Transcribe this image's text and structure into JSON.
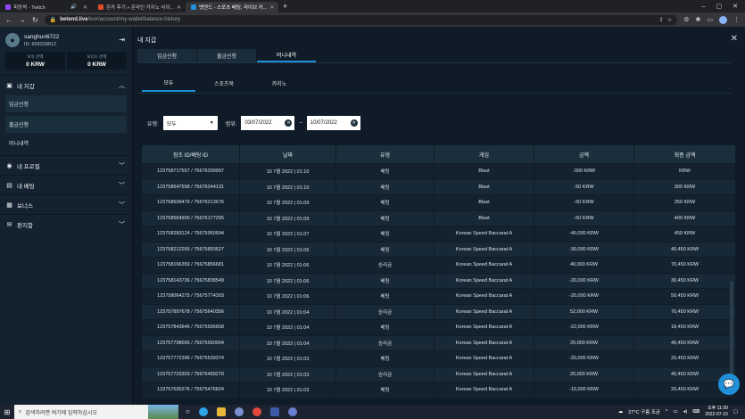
{
  "browser": {
    "tabs": [
      {
        "title": "피망싹 - Twitch",
        "active": false,
        "color": "#9146ff"
      },
      {
        "title": "온카 후기 » 온라인 카지노 사이...",
        "active": false,
        "color": "#e04a2a"
      },
      {
        "title": "벳엔드 - 스포츠 베팅, 라이브 카...",
        "active": true,
        "color": "#1f8fd8"
      }
    ],
    "url_host": "betend.live",
    "url_path": "/ko#/account/my-wallet/balance-history"
  },
  "sidebar": {
    "username": "sanghun6722",
    "user_id": "ID: 669318812",
    "balances": [
      {
        "label": "보유 잔액",
        "value": "0 KRW"
      },
      {
        "label": "보너스 잔액",
        "value": "0 KRW"
      }
    ],
    "menu": {
      "wallet": "내 지갑",
      "deposit": "입금신청",
      "withdraw": "출금신청",
      "money_history": "머니내역",
      "profile": "내 프로필",
      "bets": "내 베팅",
      "bonus": "보너스",
      "messages": "편지함"
    }
  },
  "content": {
    "title": "내 지갑",
    "main_tabs": [
      "입금신청",
      "출금신청",
      "머니내역"
    ],
    "sub_tabs": [
      "모두",
      "스포츠북",
      "카지노"
    ],
    "filters": {
      "type_label": "유형:",
      "type_value": "모두",
      "range_label": "범위:",
      "date_from": "03/07/2022",
      "date_sep": "–",
      "date_to": "10/07/2022"
    },
    "table": {
      "headers": [
        "참조 ID/베팅 ID",
        "날짜",
        "유형",
        "게임",
        "금액",
        "최종 금액"
      ],
      "rows": [
        [
          "123758717557 / 75676299997",
          "10 7월 2022 | 01:10",
          "베팅",
          "Blast",
          "-300 KRW",
          "KRW"
        ],
        [
          "123758647558 / 75676244131",
          "10 7월 2022 | 01:10",
          "베팅",
          "Blast",
          "-50 KRW",
          "300 KRW"
        ],
        [
          "123758609479 / 75676213676",
          "10 7월 2022 | 01:09",
          "베팅",
          "Blast",
          "-50 KRW",
          "350 KRW"
        ],
        [
          "123758564900 / 75676177295",
          "10 7월 2022 | 01:09",
          "베팅",
          "Blast",
          "-50 KRW",
          "400 KRW"
        ],
        [
          "123758283124 / 75675950594",
          "10 7월 2022 | 01:07",
          "베팅",
          "Korean Speed Baccarat A",
          "-40,000 KRW",
          "450 KRW"
        ],
        [
          "123758212265 / 75675893527",
          "10 7월 2022 | 01:06",
          "베팅",
          "Korean Speed Baccarat A",
          "-30,000 KRW",
          "40,450 KRW"
        ],
        [
          "123758166359 / 75675856681",
          "10 7월 2022 | 01:06",
          "승리금",
          "Korean Speed Baccarat A",
          "40,000 KRW",
          "70,450 KRW"
        ],
        [
          "123758143736 / 75675838549",
          "10 7월 2022 | 01:06",
          "베팅",
          "Korean Speed Baccarat A",
          "-20,000 KRW",
          "30,450 KRW"
        ],
        [
          "123758064275 / 75675774393",
          "10 7월 2022 | 01:06",
          "베팅",
          "Korean Speed Baccarat A",
          "-20,000 KRW",
          "50,450 KRW"
        ],
        [
          "123757897678 / 75675640356",
          "10 7월 2022 | 01:04",
          "승리금",
          "Korean Speed Baccarat A",
          "52,000 KRW",
          "70,450 KRW"
        ],
        [
          "123757843646 / 75675596658",
          "10 7월 2022 | 01:04",
          "베팅",
          "Korean Speed Baccarat A",
          "-22,000 KRW",
          "18,450 KRW"
        ],
        [
          "123757798095 / 75675560004",
          "10 7월 2022 | 01:04",
          "승리금",
          "Korean Speed Baccarat A",
          "20,000 KRW",
          "40,450 KRW"
        ],
        [
          "123757772396 / 75675539374",
          "10 7월 2022 | 01:03",
          "베팅",
          "Korean Speed Baccarat A",
          "-20,000 KRW",
          "20,450 KRW"
        ],
        [
          "123757723303 / 75675499270",
          "10 7월 2022 | 01:03",
          "승리금",
          "Korean Speed Baccarat A",
          "20,000 KRW",
          "40,450 KRW"
        ],
        [
          "123757695276 / 75675476824",
          "10 7월 2022 | 01:03",
          "베팅",
          "Korean Speed Baccarat A",
          "-10,000 KRW",
          "20,450 KRW"
        ]
      ]
    }
  },
  "taskbar": {
    "search_placeholder": "검색하려면 여기에 입력하십시오",
    "weather": "27°C 구름 조금",
    "time": "오후 11:39",
    "date": "2022-07-10"
  }
}
